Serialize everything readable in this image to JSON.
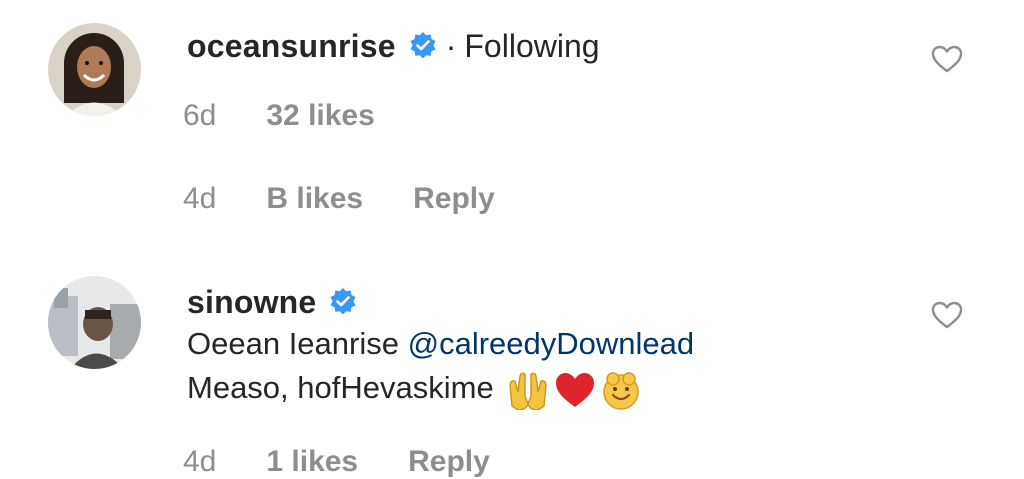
{
  "comments": [
    {
      "username": "oceansunrise",
      "verified": true,
      "separator": "·",
      "follow_status": "Following",
      "text": "",
      "meta": {
        "time": "6d",
        "likes": "32 likes",
        "reply": ""
      }
    },
    {
      "username": "",
      "verified": false,
      "text": "",
      "meta": {
        "time": "4d",
        "likes": "B likes",
        "reply": "Reply"
      }
    },
    {
      "username": "sinowne",
      "verified": true,
      "text_line1_name": "Oeean Ieanrise",
      "text_line1_mention": "@calreedyDownlead",
      "text_line2": "Measo, hofHevaskime",
      "emojis": [
        "hands-icon",
        "red-heart-icon",
        "smiling-face-icon"
      ],
      "meta": {
        "time": "4d",
        "likes": "1 likes",
        "reply": "Reply"
      }
    }
  ],
  "colors": {
    "verified_blue": "#3897f0",
    "meta_gray": "#8e8e8e",
    "heart_outline": "#8e8e8e",
    "mention_blue": "#00376b",
    "text_dark": "#262626"
  }
}
